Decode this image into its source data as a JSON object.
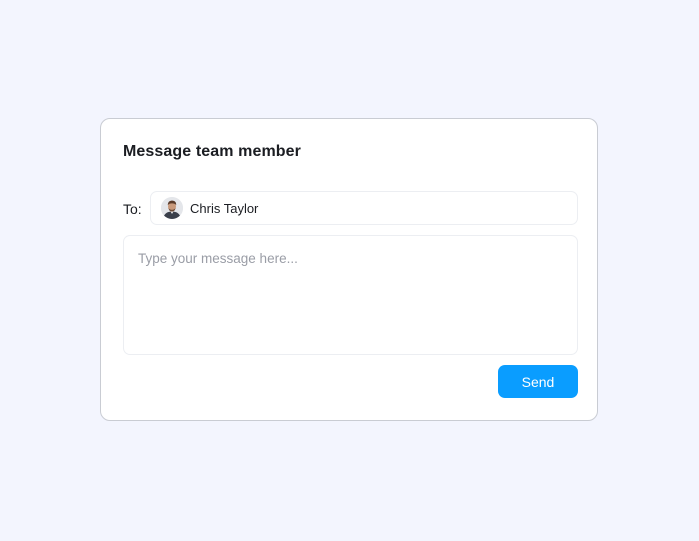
{
  "dialog": {
    "title": "Message team member",
    "to_label": "To:",
    "recipient": {
      "name": "Chris Taylor",
      "avatar_icon": "user-avatar-photo"
    },
    "message": {
      "value": "",
      "placeholder": "Type your message here..."
    },
    "send_label": "Send"
  },
  "colors": {
    "page_background": "#f3f5fe",
    "card_background": "#ffffff",
    "card_border": "#c9ccd3",
    "primary_button": "#0a9dff",
    "text": "#1b1d22",
    "placeholder": "#9a9da6"
  }
}
